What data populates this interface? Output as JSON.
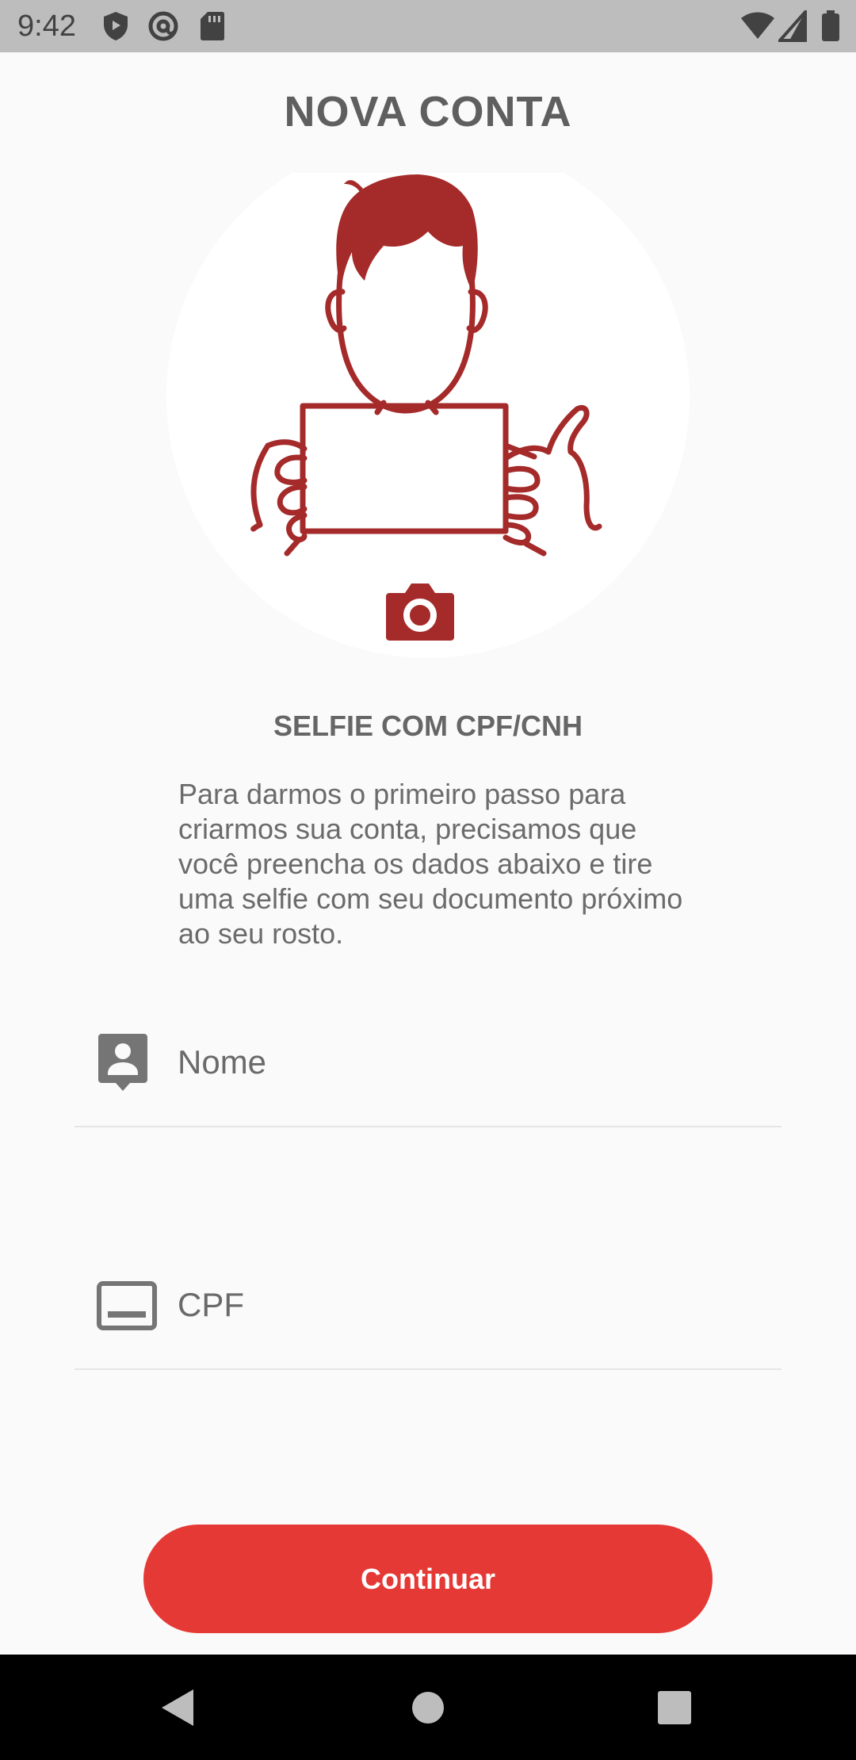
{
  "status_bar": {
    "time": "9:42",
    "icons": [
      "shield-icon",
      "at-icon",
      "sd-card-icon",
      "wifi-icon",
      "signal-icon",
      "battery-icon"
    ]
  },
  "header": {
    "title": "NOVA CONTA"
  },
  "illustration": {
    "subject": "person-holding-document-illustration",
    "camera_icon": "camera-icon",
    "accent_color": "#a52a2a"
  },
  "selfie": {
    "title": "SELFIE COM CPF/CNH",
    "description": "Para darmos o primeiro passo para criarmos sua conta, precisamos que você preencha os dados abaixo e tire uma selfie com seu documento próximo ao seu rosto."
  },
  "form": {
    "name_field": {
      "placeholder": "Nome",
      "value": "",
      "icon": "contact-icon"
    },
    "cpf_field": {
      "placeholder": "CPF",
      "value": "",
      "icon": "id-card-icon"
    }
  },
  "actions": {
    "continue_label": "Continuar",
    "button_color": "#e53935"
  },
  "nav_bar": {
    "icons": [
      "back-icon",
      "home-icon",
      "recents-icon"
    ]
  }
}
